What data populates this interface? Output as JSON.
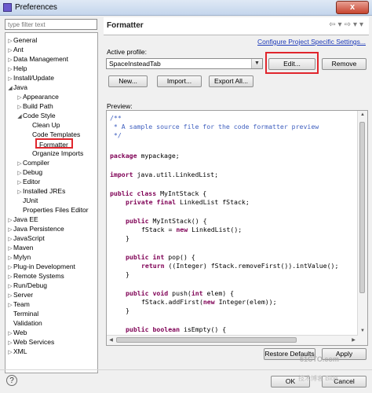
{
  "window": {
    "title": "Preferences",
    "close": "x"
  },
  "filter": {
    "placeholder": "type filter text"
  },
  "tree": {
    "general": "General",
    "ant": "Ant",
    "data_management": "Data Management",
    "help": "Help",
    "install_update": "Install/Update",
    "java": "Java",
    "appearance": "Appearance",
    "build_path": "Build Path",
    "code_style": "Code Style",
    "clean_up": "Clean Up",
    "code_templates": "Code Templates",
    "formatter": "Formatter",
    "organize_imports": "Organize Imports",
    "compiler": "Compiler",
    "debug": "Debug",
    "editor": "Editor",
    "installed_jres": "Installed JREs",
    "junit": "JUnit",
    "properties_files_editor": "Properties Files Editor",
    "java_ee": "Java EE",
    "java_persistence": "Java Persistence",
    "javascript": "JavaScript",
    "maven": "Maven",
    "mylyn": "Mylyn",
    "plugin_development": "Plug-in Development",
    "remote_systems": "Remote Systems",
    "run_debug": "Run/Debug",
    "server": "Server",
    "team": "Team",
    "terminal": "Terminal",
    "validation": "Validation",
    "web": "Web",
    "web_services": "Web Services",
    "xml": "XML"
  },
  "page": {
    "title": "Formatter",
    "configure_link": "Configure Project Specific Settings...",
    "active_profile_label": "Active profile:",
    "active_profile_value": "SpaceInsteadTab",
    "edit_button": "Edit...",
    "remove_button": "Remove",
    "new_button": "New...",
    "import_button": "Import...",
    "export_all_button": "Export All...",
    "preview_label": "Preview:",
    "restore_defaults_button": "Restore Defaults",
    "apply_button": "Apply"
  },
  "code": {
    "l1": "/**",
    "l2": " * A sample source file for the code formatter preview",
    "l3": " */",
    "l4_kw": "package",
    "l4_rest": " mypackage;",
    "l5_kw": "import",
    "l5_rest": " java.util.LinkedList;",
    "l6_kw1": "public class",
    "l6_rest": " MyIntStack {",
    "l7_kw": "private final",
    "l7_rest": " LinkedList fStack;",
    "l8_kw": "public",
    "l8_rest": " MyIntStack() {",
    "l9_a": "fStack = ",
    "l9_kw": "new",
    "l9_b": " LinkedList();",
    "l10": "}",
    "l11_kw": "public int",
    "l11_rest": " pop() {",
    "l12_kw": "return",
    "l12_rest": " ((Integer) fStack.removeFirst()).intValue();",
    "l13": "}",
    "l14_kw": "public void",
    "l14_rest1": " push(",
    "l14_kw2": "int",
    "l14_rest2": " elem) {",
    "l15_a": "fStack.addFirst(",
    "l15_kw": "new",
    "l15_b": " Integer(elem));",
    "l16": "}",
    "l17_kw": "public boolean",
    "l17_rest": " isEmpty() {"
  },
  "footer": {
    "ok_button": "OK",
    "cancel_button": "Cancel",
    "help_icon": "?",
    "watermark_site": "51CTO.com",
    "watermark_text": "技术博客 Blog"
  },
  "colors": {
    "highlight": "#e0262d",
    "link": "#1b38b8",
    "comment": "#3f5fbf",
    "keyword": "#7f0055"
  }
}
